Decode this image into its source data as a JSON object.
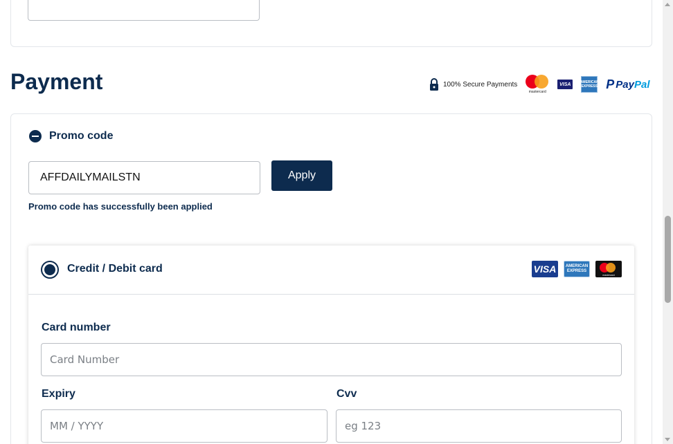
{
  "page": {
    "title": "Payment"
  },
  "trust_bar": {
    "secure_text": "100% Secure Payments",
    "icons": [
      "lock-icon",
      "mastercard-icon",
      "visa-icon",
      "amex-icon",
      "paypal-icon"
    ],
    "mastercard_text": "mastercard",
    "visa_text": "VISA",
    "amex_text": "AMERICAN EXPRESS",
    "paypal_text": {
      "pay": "Pay",
      "pal": "Pal"
    }
  },
  "promo": {
    "toggle_label": "Promo code",
    "code_value": "AFFDAILYMAILSTN",
    "apply_label": "Apply",
    "success_message": "Promo code has successfully been applied"
  },
  "card_payment": {
    "method_label": "Credit / Debit card",
    "selected": true,
    "brand_logos": {
      "visa": "VISA",
      "amex": "AMERICAN EXPRESS",
      "mastercard": "mastercard"
    },
    "card_number": {
      "label": "Card number",
      "placeholder": "Card Number",
      "value": ""
    },
    "expiry": {
      "label": "Expiry",
      "placeholder": "MM / YYYY",
      "value": ""
    },
    "cvv": {
      "label": "Cvv",
      "placeholder": "eg 123",
      "value": ""
    }
  },
  "colors": {
    "brand_navy": "#0d2b4e",
    "border": "#b9bdc3"
  }
}
